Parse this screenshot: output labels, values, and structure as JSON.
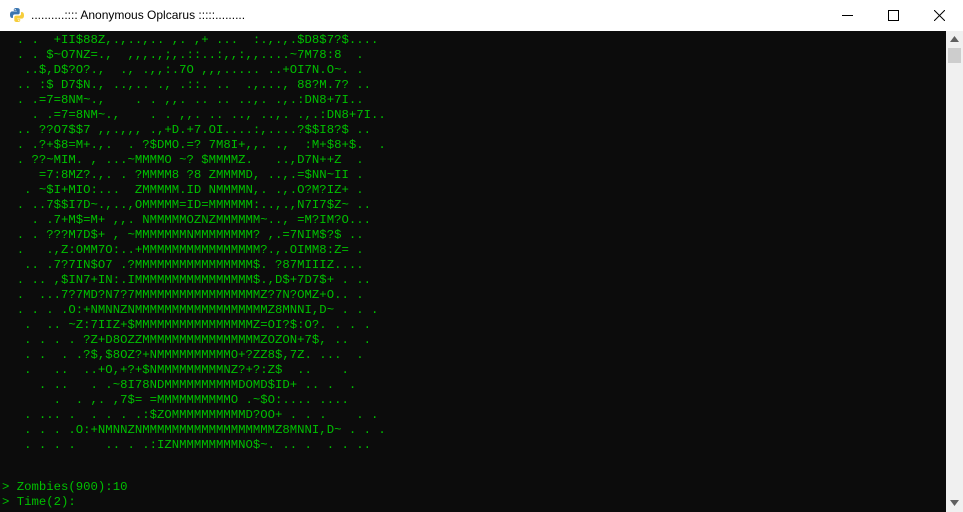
{
  "window": {
    "title": "..........:::: Anonymous Oplcarus :::::.........",
    "icon": "python-icon"
  },
  "controls": {
    "minimize_icon": "minimize-icon",
    "maximize_icon": "maximize-icon",
    "close_icon": "close-icon"
  },
  "colors": {
    "console_background": "#0c0c0c",
    "console_text": "#00c000",
    "titlebar": "#ffffff"
  },
  "console": {
    "art_lines": [
      "  . .  +II$88Z,.,..,.. ,. ,+ ...  :.,.,.$D8$7?$....",
      "  . . $~O7NZ=.,  ,,,.,;,.::..:,,:,,....~7M78:8  .",
      "   ..$,D$?O?.,  ., .,,:.7O ,,,..... ..+OI7N.O~. .",
      "  .. :$ D7$N., ..,.. ., .::. ..  .,..., 88?M.7? ..",
      "  . .=7=8NM~.,    . . ,,. .. .. ..,. .,.:DN8+7I..",
      "    . .=7=8NM~.,    . . ,,. .. .., ..,. .,.:DN8+7I..",
      "  .. ??O7$$7 ,,.,,, .,+D.+7.OI....:,....?$$I8?$ ..",
      "  . .?+$8=M+.,.  . ?$DMO.=? 7M8I+,,. .,  :M+$8+$.  .",
      "  . ??~MIM. , ...~MMMMO ~? $MMMMZ.   ..,D7N++Z  .",
      "     =7:8MZ?.,. . ?MMMM8 ?8 ZMMMMD, ..,.=$NN~II .",
      "   . ~$I+MIO:...  ZMMMMM.ID NMMMMN,. .,.O?M?IZ+ .",
      "  . ..7$$I7D~.,..,OMMMMM=ID=MMMMMM:..,.,N7I7$Z~ ..",
      "    . .7+M$=M+ ,,. NMMMMMOZNZMMMMMM~.., =M?IM?O...",
      "  . . ???M7D$+ , ~MMMMMMMNMMMMMMMM? ,.=7NIM$?$ ..",
      "  .   .,Z:OMM7O:..+MMMMMMMMMMMMMMMM?.,.OIMM8:Z= .",
      "   .. .7?7IN$O7 .?MMMMMMMMMMMMMMMM$. ?87MIIIZ....",
      "  . .. ,$IN7+IN:.IMMMMMMMMMMMMMMMM$.,D$+7D7$+ . ..",
      "  .  ...7?7MD?N7?7MMMMMMMMMMMMMMMMMZ?7N?OMZ+O.. .",
      "  . . . .O:+NMNNZNMMMMMMMMMMMMMMMMMMZ8MNNI,D~ . . .",
      "   .  .. ~Z:7IIZ+$MMMMMMMMMMMMMMMMZ=OI?$:O?. . . .",
      "   . . . . ?Z+D8OZZMMMMMMMMMMMMMMMMZOZON+7$, ..  .",
      "   . .  . .?$,$8OZ?+NMMMMMMMMMMO+?ZZ8$,7Z. ...  .",
      "   .   ..  ..+O,+?+$NMMMMMMMMMNZ?+?:Z$  ..    .",
      "     . ..   . .~8I78NDMMMMMMMMMMDOMD$ID+ .. .  .",
      "       .  . ,. ,7$= =MMMMMMMMMMO .~$O:.... ....",
      "   . ... .  . . . .:$ZOMMMMMMMMMMD?OO+ . . .    . .",
      "   . . . .O:+NMNNZNMMMMMMMMMMMMMMMMMMZ8MNNI,D~ . . .",
      "   . . . .    .. . .:IZNMMMMMMMMNO$~. .. .  . . .."
    ],
    "prompt_lines": [
      "> Zombies(900):10",
      "> Time(2):"
    ]
  },
  "scrollbar": {
    "up_icon": "scroll-up-arrow-icon",
    "down_icon": "scroll-down-arrow-icon"
  }
}
